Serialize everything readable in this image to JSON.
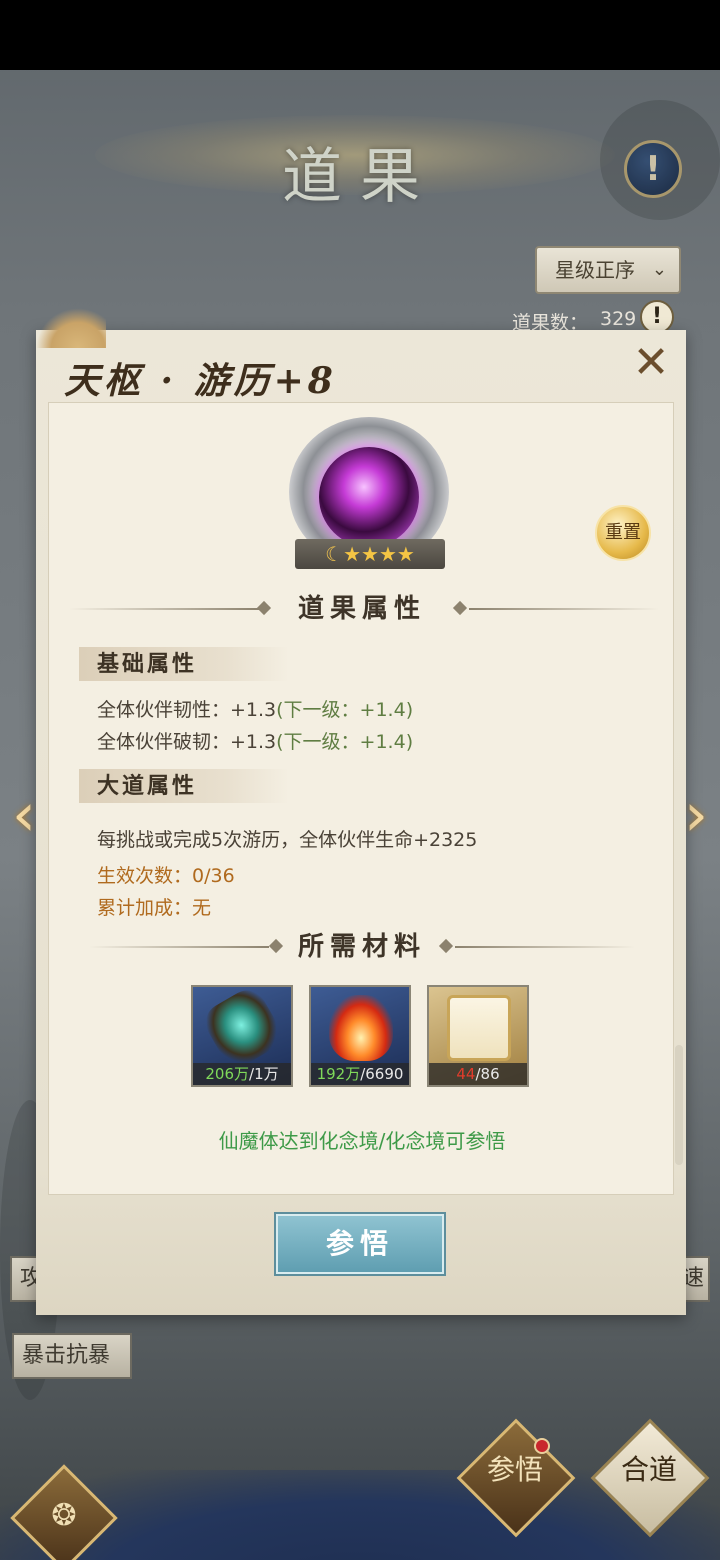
{
  "header": {
    "title": "道果",
    "help_icon": "!",
    "sort_label": "星级正序",
    "count_label": "道果数：",
    "count_value": "329",
    "count_info_icon": "!"
  },
  "background_tags": {
    "left_partial": "攻",
    "right_partial": "速",
    "crit": "暴击抗暴"
  },
  "bottom_nav": {
    "canwu": "参悟",
    "hedao": "合道"
  },
  "dialog": {
    "title": "天枢 · 游历+8",
    "close_icon": "✕",
    "stars": 4,
    "reset_label": "重置",
    "attributes_header": "道果属性",
    "base_header": "基础属性",
    "base_attrs": [
      {
        "text": "全体伙伴韧性：+1.3",
        "next": "(下一级：+1.4)"
      },
      {
        "text": "全体伙伴破韧：+1.3",
        "next": "(下一级：+1.4)"
      }
    ],
    "dao_header": "大道属性",
    "dao_desc": "每挑战或完成5次游历，全体伙伴生命+2325",
    "effect_count": "生效次数：0/36",
    "cumulative": "累计加成：无",
    "materials_header": "所需材料",
    "materials": [
      {
        "have": "206万",
        "need": "/1万",
        "enough": true
      },
      {
        "have": "192万",
        "need": "/6690",
        "enough": true
      },
      {
        "have": "44",
        "need": "/86",
        "enough": false
      }
    ],
    "hint": "仙魔体达到化念境/化念境可参悟",
    "action_label": "参悟"
  },
  "colors": {
    "accent_gold": "#b06a1e",
    "hint_green": "#3e9a48",
    "insufficient_red": "#e23c2c"
  }
}
